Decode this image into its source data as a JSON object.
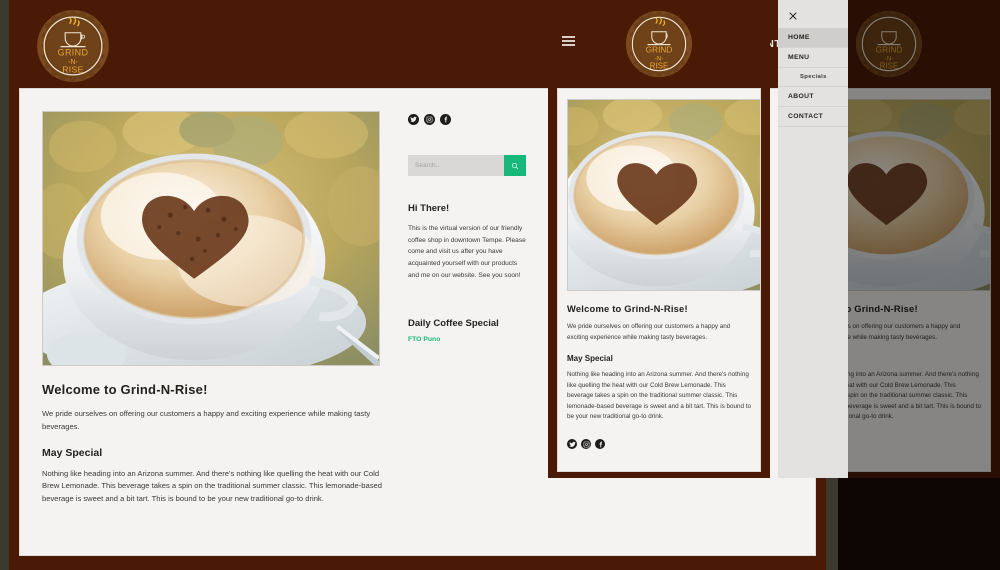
{
  "brand": {
    "name_line1": "GRIND",
    "name_line2": "-N-",
    "name_line3": "RISE",
    "logo_icon": "coffee-cup-badge-icon",
    "header_bg": "#4a1a06",
    "accent_green": "#16b877"
  },
  "nav": {
    "items": [
      {
        "label": "HOME",
        "active": true
      },
      {
        "label": "MENU",
        "active": false,
        "has_dropdown": true
      },
      {
        "label": "ABOUT",
        "active": false
      },
      {
        "label": "CONTACT",
        "active": false
      }
    ]
  },
  "hero": {
    "image_alt": "cappuccino-with-chocolate-heart-photo"
  },
  "main": {
    "title": "Welcome to Grind-N-Rise!",
    "intro": "We pride ourselves on offering our customers a happy and exciting experience while making tasty beverages.",
    "special_heading": "May Special",
    "special_body": "Nothing like heading into an Arizona summer. And there's nothing like quelling the heat with our Cold Brew Lemonade. This beverage takes a spin on the traditional summer classic. This lemonade-based beverage is sweet and a bit tart. This is bound to be your new traditional go-to drink."
  },
  "sidebar": {
    "socials": [
      {
        "name": "twitter-icon",
        "label": "Twitter"
      },
      {
        "name": "instagram-icon",
        "label": "Instagram"
      },
      {
        "name": "facebook-icon",
        "label": "Facebook"
      }
    ],
    "search": {
      "placeholder": "Search..",
      "value": "",
      "button_icon": "search-icon"
    },
    "about_heading": "Hi There!",
    "about_body": "This is the virtual version of our friendly coffee shop in downtown Tempe. Please come and visit us after you have acquainted yourself with our products and me on our website. See you soon!",
    "special_heading": "Daily Coffee Special",
    "special_link": "FTO Puno"
  },
  "mobile": {
    "menu_toggle_icon": "hamburger-menu-icon"
  },
  "drawer": {
    "close_icon": "close-x-icon",
    "items": [
      {
        "label": "HOME",
        "active": true,
        "child": false
      },
      {
        "label": "MENU",
        "active": false,
        "child": false
      },
      {
        "label": "Specials",
        "active": false,
        "child": true
      },
      {
        "label": "ABOUT",
        "active": false,
        "child": false
      },
      {
        "label": "CONTACT",
        "active": false,
        "child": false
      }
    ]
  }
}
